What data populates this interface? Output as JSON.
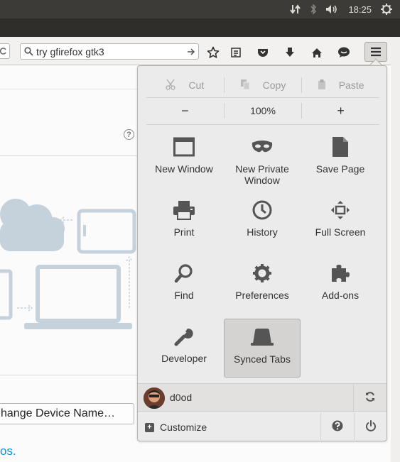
{
  "system_tray": {
    "clock": "18:25",
    "icons": [
      "network-arrows-icon",
      "bluetooth-icon",
      "volume-icon",
      "power-gear-icon"
    ]
  },
  "toolbar": {
    "search_value": "try gfirefox gtk3",
    "icons": [
      "bookmark-star-icon",
      "reading-list-icon",
      "pocket-icon",
      "downloads-icon",
      "home-icon",
      "chat-icon",
      "hamburger-menu-icon"
    ]
  },
  "page": {
    "device_name_button": "hange Device Name…",
    "link_tail": "os."
  },
  "menu": {
    "edit": {
      "cut": "Cut",
      "copy": "Copy",
      "paste": "Paste"
    },
    "zoom": {
      "minus": "−",
      "level": "100%",
      "plus": "+"
    },
    "items": [
      {
        "label": "New Window",
        "icon": "new-window-icon"
      },
      {
        "label": "New Private Window",
        "icon": "private-mask-icon"
      },
      {
        "label": "Save Page",
        "icon": "save-page-icon"
      },
      {
        "label": "Print",
        "icon": "printer-icon"
      },
      {
        "label": "History",
        "icon": "clock-icon"
      },
      {
        "label": "Full Screen",
        "icon": "fullscreen-icon"
      },
      {
        "label": "Find",
        "icon": "magnifier-icon"
      },
      {
        "label": "Preferences",
        "icon": "gear-icon"
      },
      {
        "label": "Add-ons",
        "icon": "puzzle-icon"
      },
      {
        "label": "Developer",
        "icon": "wrench-icon"
      },
      {
        "label": "Synced Tabs",
        "icon": "synced-tabs-icon"
      }
    ],
    "account": {
      "name": "d0od"
    },
    "footer": {
      "customize": "Customize"
    }
  },
  "colors": {
    "panel_bg": "#ebebeb",
    "icon_gray": "#555555",
    "illustration": "#c5d2dc",
    "link_blue": "#0b8fd8",
    "topbar": "#3c3b37"
  }
}
